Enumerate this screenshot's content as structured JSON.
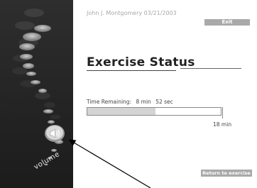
{
  "header": {
    "user_name": "John J. Montgomery",
    "date": "03/21/2003",
    "exit_label": "Exit"
  },
  "main": {
    "title": "Exercise Status",
    "time_label": "Time Remaining:",
    "minutes_remaining": "8 min",
    "seconds_remaining": "52 sec",
    "total_label": "18 min",
    "elapsed_fraction": 0.51
  },
  "sidebar": {
    "volume_label": "volume",
    "speaker_icon": "speaker-icon"
  },
  "footer": {
    "return_label": "Return to exercise"
  },
  "colors": {
    "sidebar_bg": "#252525",
    "button_bg": "#a9a9a9",
    "progress_fill": "#d4d4d4"
  }
}
